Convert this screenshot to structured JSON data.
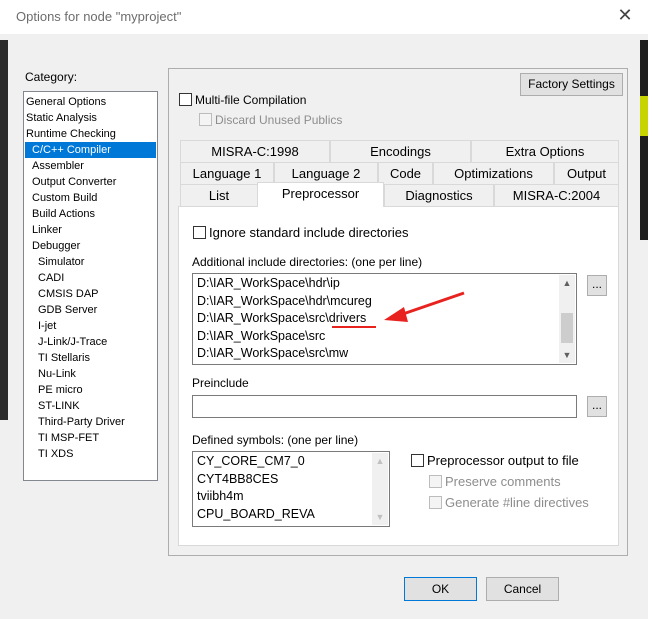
{
  "window": {
    "title": "Options for node \"myproject\"",
    "close_symbol": "✕"
  },
  "category": {
    "label": "Category:",
    "items": [
      {
        "label": "General Options",
        "indent": 0,
        "selected": false
      },
      {
        "label": "Static Analysis",
        "indent": 0,
        "selected": false
      },
      {
        "label": "Runtime Checking",
        "indent": 0,
        "selected": false
      },
      {
        "label": "C/C++ Compiler",
        "indent": 1,
        "selected": true
      },
      {
        "label": "Assembler",
        "indent": 1,
        "selected": false
      },
      {
        "label": "Output Converter",
        "indent": 1,
        "selected": false
      },
      {
        "label": "Custom Build",
        "indent": 1,
        "selected": false
      },
      {
        "label": "Build Actions",
        "indent": 1,
        "selected": false
      },
      {
        "label": "Linker",
        "indent": 1,
        "selected": false
      },
      {
        "label": "Debugger",
        "indent": 1,
        "selected": false
      },
      {
        "label": "Simulator",
        "indent": 2,
        "selected": false
      },
      {
        "label": "CADI",
        "indent": 2,
        "selected": false
      },
      {
        "label": "CMSIS DAP",
        "indent": 2,
        "selected": false
      },
      {
        "label": "GDB Server",
        "indent": 2,
        "selected": false
      },
      {
        "label": "I-jet",
        "indent": 2,
        "selected": false
      },
      {
        "label": "J-Link/J-Trace",
        "indent": 2,
        "selected": false
      },
      {
        "label": "TI Stellaris",
        "indent": 2,
        "selected": false
      },
      {
        "label": "Nu-Link",
        "indent": 2,
        "selected": false
      },
      {
        "label": "PE micro",
        "indent": 2,
        "selected": false
      },
      {
        "label": "ST-LINK",
        "indent": 2,
        "selected": false
      },
      {
        "label": "Third-Party Driver",
        "indent": 2,
        "selected": false
      },
      {
        "label": "TI MSP-FET",
        "indent": 2,
        "selected": false
      },
      {
        "label": "TI XDS",
        "indent": 2,
        "selected": false
      }
    ]
  },
  "panel": {
    "factory_settings": "Factory Settings",
    "multifile_compilation": {
      "label": "Multi-file Compilation",
      "checked": false
    },
    "discard_unused_publics": {
      "label": "Discard Unused Publics",
      "checked": false,
      "enabled": false
    }
  },
  "tabs": {
    "row1": [
      "MISRA-C:1998",
      "Encodings",
      "Extra Options"
    ],
    "row2": [
      "Language 1",
      "Language 2",
      "Code",
      "Optimizations",
      "Output"
    ],
    "row3": [
      "List",
      "Preprocessor",
      "Diagnostics",
      "MISRA-C:2004"
    ],
    "active": "Preprocessor"
  },
  "preprocessor": {
    "ignore_std_include": {
      "label": "Ignore standard include directories",
      "checked": false
    },
    "include_dirs_label": "Additional include directories: (one per line)",
    "include_dirs": [
      "D:\\IAR_WorkSpace\\hdr\\ip",
      "D:\\IAR_WorkSpace\\hdr\\mcureg",
      "D:\\IAR_WorkSpace\\src\\drivers",
      "D:\\IAR_WorkSpace\\src",
      "D:\\IAR_WorkSpace\\src\\mw"
    ],
    "browse_label": "...",
    "preinclude_label": "Preinclude",
    "preinclude_value": "",
    "defined_symbols_label": "Defined symbols: (one per line)",
    "defined_symbols": [
      "CY_CORE_CM7_0",
      "CYT4BB8CES",
      "tviibh4m",
      "CPU_BOARD_REVA"
    ],
    "preprocessor_output": {
      "label": "Preprocessor output to file",
      "checked": false
    },
    "preserve_comments": {
      "label": "Preserve comments",
      "checked": false,
      "enabled": false
    },
    "generate_line": {
      "label": "Generate #line directives",
      "checked": false,
      "enabled": false
    }
  },
  "annotation": {
    "color": "#e8231f",
    "highlighted_entry": "drivers"
  },
  "buttons": {
    "ok": "OK",
    "cancel": "Cancel"
  },
  "colors": {
    "selection": "#0078d7",
    "dialog_bg": "#f0f0f0",
    "annotation_red": "#e8231f"
  }
}
